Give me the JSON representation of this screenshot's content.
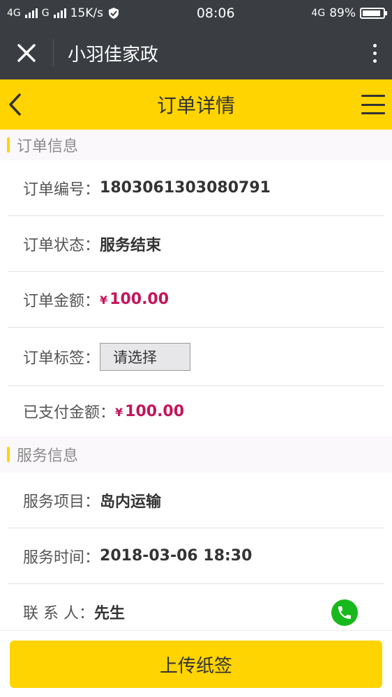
{
  "status_bar": {
    "network1": "4G",
    "network2": "G",
    "speed": "15K/s",
    "time": "08:06",
    "network_right": "4G",
    "battery": "89%",
    "battery_level": 0.89
  },
  "wechat_bar": {
    "title": "小羽佳家政"
  },
  "header": {
    "title": "订单详情"
  },
  "order_section": {
    "title": "订单信息",
    "order_no": {
      "label": "订单编号：",
      "value": "1803061303080791"
    },
    "status": {
      "label": "订单状态：",
      "value": "服务结束"
    },
    "amount": {
      "label": "订单金额：",
      "currency": "¥",
      "value": "100.00"
    },
    "tag": {
      "label": "订单标签：",
      "select_value": "请选择"
    },
    "paid": {
      "label": "已支付金额：",
      "currency": "¥",
      "value": "100.00"
    }
  },
  "service_section": {
    "title": "服务信息",
    "item": {
      "label": "服务项目：",
      "value": "岛内运输"
    },
    "time": {
      "label": "服务时间：",
      "value": "2018-03-06 18:30"
    },
    "contact": {
      "label": "联 系 人：",
      "value": "先生"
    }
  },
  "bottom": {
    "upload_label": "上传纸签"
  },
  "colors": {
    "accent": "#ffd400",
    "money": "#c4145c",
    "phone": "#19b81d",
    "dark_bar": "#3a3d42"
  }
}
